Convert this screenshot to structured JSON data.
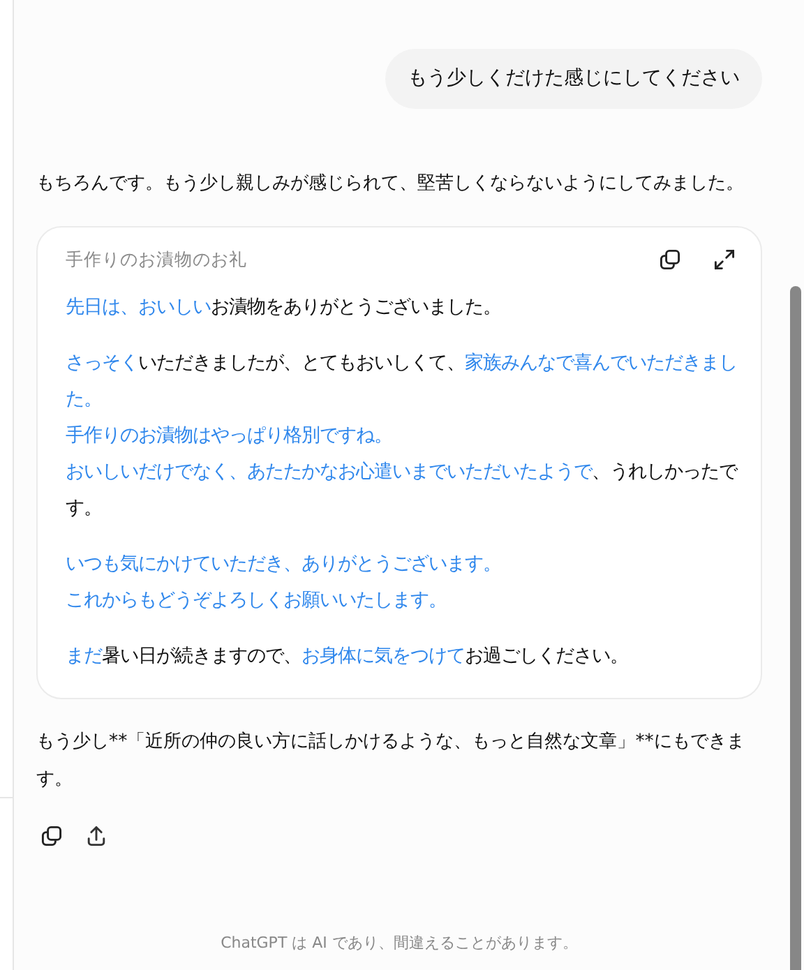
{
  "user_message": {
    "text": "もう少しくだけた感じにしてください"
  },
  "assistant": {
    "intro": "もちろんです。もう少し親しみが感じられて、堅苦しくならないようにしてみました。",
    "card": {
      "title": "手作りのお漬物のお礼",
      "paragraphs": [
        {
          "lines": [
            [
              {
                "text": "先日は、おいしい",
                "highlighted": true
              },
              {
                "text": "お漬物をありがとうございました。",
                "highlighted": false
              }
            ]
          ]
        },
        {
          "lines": [
            [
              {
                "text": "さっそく",
                "highlighted": true
              },
              {
                "text": "いただきましたが、とてもおいしくて、",
                "highlighted": false
              },
              {
                "text": "家族みんなで喜んでいただきまし",
                "highlighted": true
              }
            ],
            [
              {
                "text": "た。",
                "highlighted": true
              }
            ],
            [
              {
                "text": "手作りのお漬物はやっぱり格別ですね。",
                "highlighted": true
              }
            ],
            [
              {
                "text": "おいしいだけでなく、あたたかなお心遣いまでいただいたようで",
                "highlighted": true
              },
              {
                "text": "、うれしかったで",
                "highlighted": false
              }
            ],
            [
              {
                "text": "す。",
                "highlighted": false
              }
            ]
          ]
        },
        {
          "lines": [
            [
              {
                "text": "いつも気にかけていただき、ありがとうございます。",
                "highlighted": true
              }
            ],
            [
              {
                "text": "これからもどうぞよろしくお願いいたします。",
                "highlighted": true
              }
            ]
          ]
        },
        {
          "lines": [
            [
              {
                "text": "まだ",
                "highlighted": true
              },
              {
                "text": "暑い日が続きますので、",
                "highlighted": false
              },
              {
                "text": "お身体に気をつけて",
                "highlighted": true
              },
              {
                "text": "お過ごしください。",
                "highlighted": false
              }
            ]
          ]
        }
      ]
    },
    "closing": {
      "lines": [
        "もう少し**「近所の仲の良い方に話しかけるような、もっと自然な文章」**にもできま",
        "す。"
      ]
    }
  },
  "footer": "ChatGPT は AI であり、間違えることがあります。"
}
